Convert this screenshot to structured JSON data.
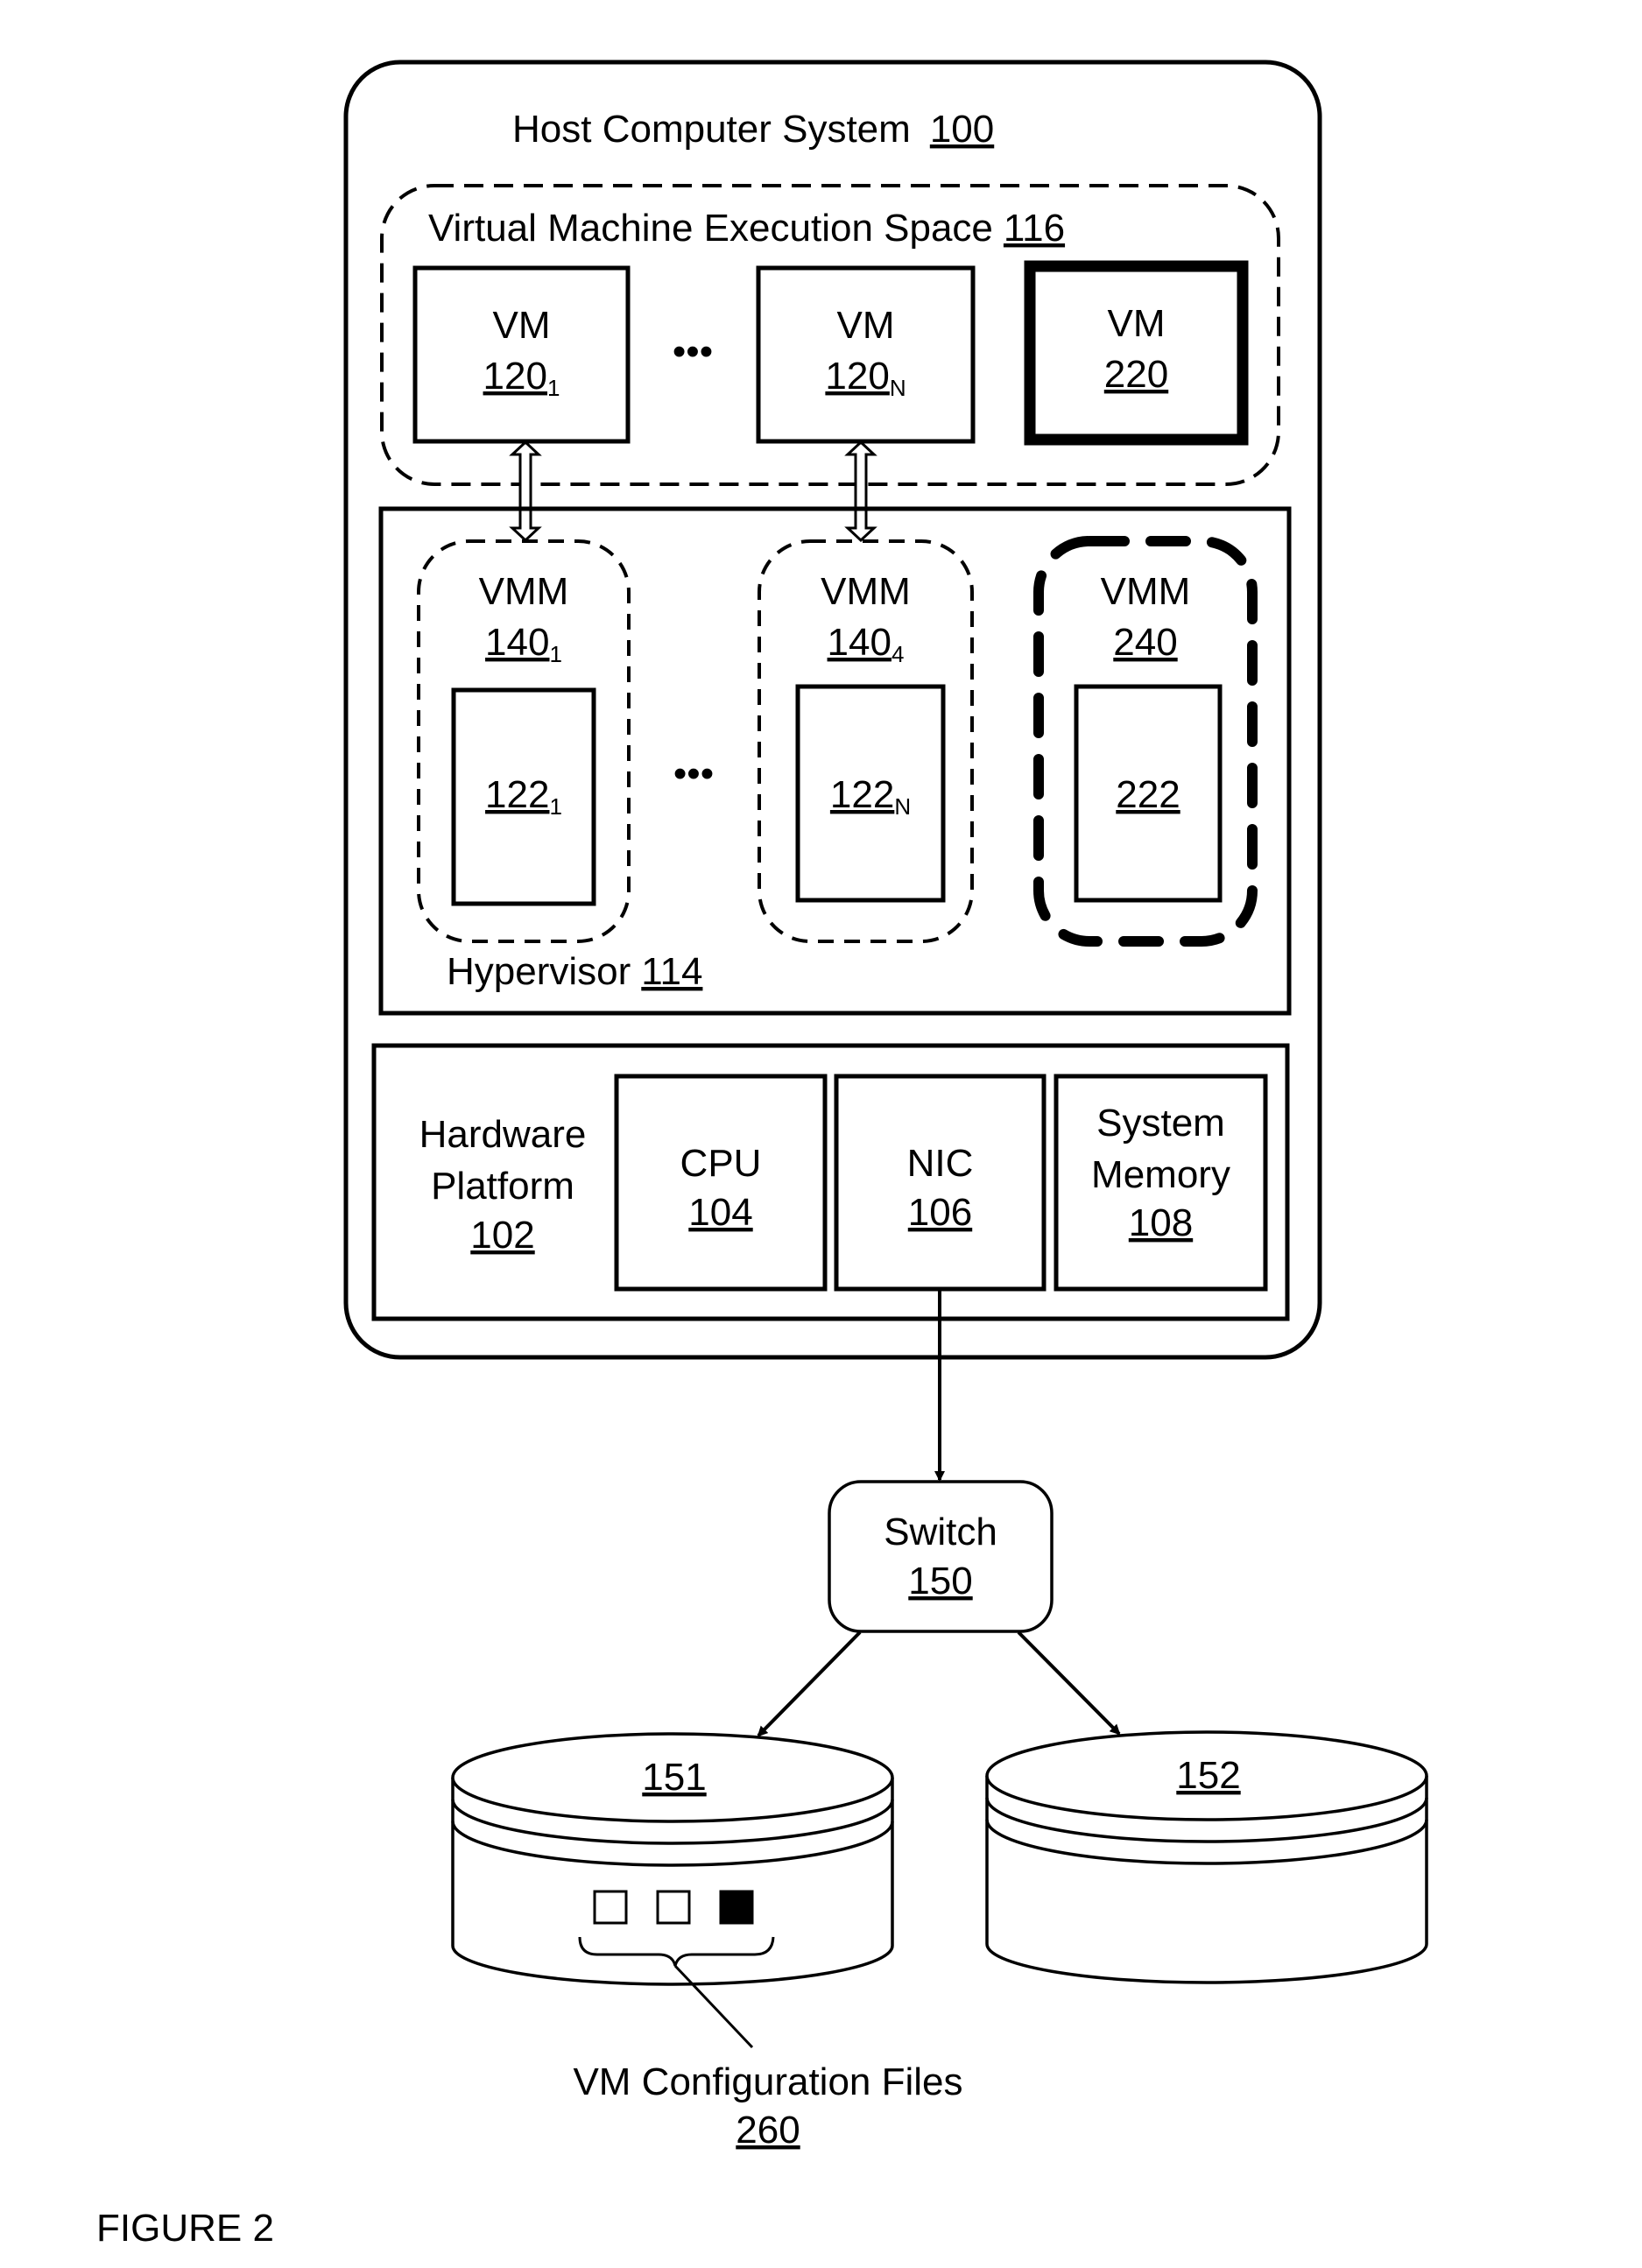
{
  "figure": {
    "caption": "FIGURE 2",
    "colors": {
      "ink": "#000000",
      "paper": "#ffffff"
    }
  },
  "host": {
    "title": "Host Computer System",
    "ref": "100"
  },
  "vm_space": {
    "title": "Virtual Machine Execution Space",
    "ref": "116",
    "vms": [
      {
        "label": "VM",
        "ref": "120",
        "sub": "1",
        "style": "normal"
      },
      {
        "label": "VM",
        "ref": "120",
        "sub": "N",
        "style": "normal"
      },
      {
        "label": "VM",
        "ref": "220",
        "sub": "",
        "style": "bold"
      }
    ],
    "ellipsis": "•••"
  },
  "hypervisor": {
    "title": "Hypervisor",
    "ref": "114",
    "vmms": [
      {
        "label": "VMM",
        "ref": "140",
        "sub": "1",
        "inner_ref": "122",
        "inner_sub": "1",
        "style": "dashed"
      },
      {
        "label": "VMM",
        "ref": "140",
        "sub": "4",
        "inner_ref": "122",
        "inner_sub": "N",
        "style": "dashed"
      },
      {
        "label": "VMM",
        "ref": "240",
        "sub": "",
        "inner_ref": "222",
        "inner_sub": "",
        "style": "bold-dashed"
      }
    ],
    "ellipsis": "•••"
  },
  "hardware": {
    "title_line1": "Hardware",
    "title_line2": "Platform",
    "ref": "102",
    "components": [
      {
        "line1": "CPU",
        "line2": "",
        "ref": "104"
      },
      {
        "line1": "NIC",
        "line2": "",
        "ref": "106"
      },
      {
        "line1": "System",
        "line2": "Memory",
        "ref": "108"
      }
    ]
  },
  "switch": {
    "label": "Switch",
    "ref": "150"
  },
  "storage": [
    {
      "ref": "151",
      "files": [
        {
          "state": "empty"
        },
        {
          "state": "empty"
        },
        {
          "state": "filled"
        }
      ]
    },
    {
      "ref": "152",
      "files": []
    }
  ],
  "config_files": {
    "label": "VM Configuration Files",
    "ref": "260"
  }
}
